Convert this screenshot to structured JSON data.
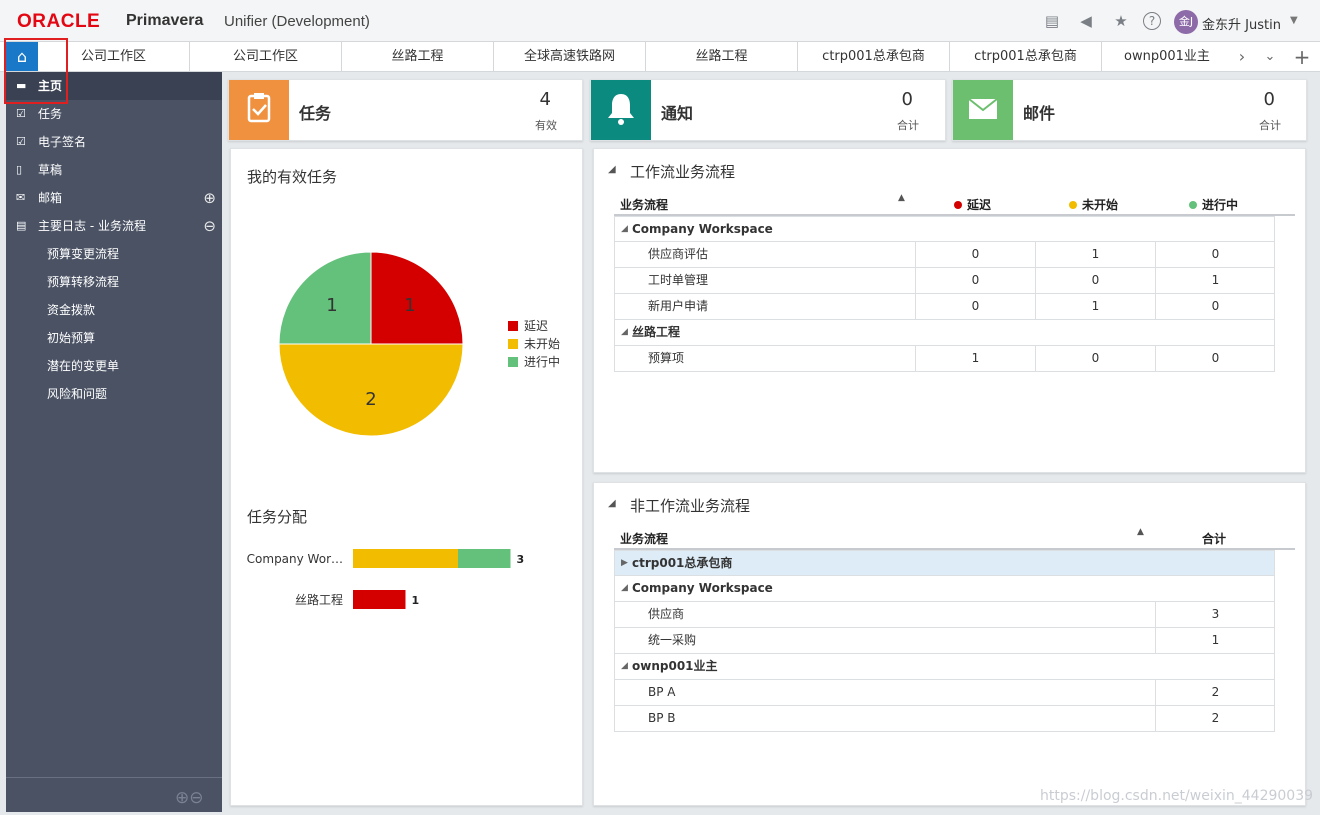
{
  "header": {
    "logo": "ORACLE",
    "product": "Primavera",
    "app": "Unifier  (Development)",
    "user_initials": "金J",
    "user_name": "金东升 Justin"
  },
  "tabs": [
    "公司工作区",
    "公司工作区",
    "丝路工程",
    "全球高速铁路网",
    "丝路工程",
    "ctrp001总承包商",
    "ctrp001总承包商",
    "ownp001业主"
  ],
  "sidebar": {
    "items": [
      {
        "label": "主页",
        "icon": "folder-icon"
      },
      {
        "label": "任务",
        "icon": "task-icon"
      },
      {
        "label": "电子签名",
        "icon": "signature-icon"
      },
      {
        "label": "草稿",
        "icon": "draft-icon"
      },
      {
        "label": "邮箱",
        "icon": "mail-icon"
      },
      {
        "label": "主要日志 - 业务流程",
        "icon": "log-icon"
      }
    ],
    "subitems": [
      "预算变更流程",
      "预算转移流程",
      "资金拨款",
      "初始预算",
      "潜在的变更单",
      "风险和问题"
    ]
  },
  "kpi": [
    {
      "title": "任务",
      "value": "4",
      "sub": "有效",
      "color": "#f0913f"
    },
    {
      "title": "通知",
      "value": "0",
      "sub": "合计",
      "color": "#0b8a80"
    },
    {
      "title": "邮件",
      "value": "0",
      "sub": "合计",
      "color": "#6cbf6e"
    }
  ],
  "tasks_panel": {
    "title": "我的有效任务"
  },
  "chart_data": [
    {
      "type": "pie",
      "categories": [
        "延迟",
        "未开始",
        "进行中"
      ],
      "values": [
        1,
        2,
        1
      ],
      "colors": [
        "#d40000",
        "#f2bc00",
        "#64c17b"
      ],
      "legend": "right"
    },
    {
      "type": "bar",
      "title": "任务分配",
      "stacked": true,
      "orientation": "horizontal",
      "categories": [
        "Company Wor…",
        "丝路工程"
      ],
      "series": [
        {
          "name": "延迟",
          "values": [
            0,
            1
          ],
          "color": "#d40000"
        },
        {
          "name": "未开始",
          "values": [
            2,
            0
          ],
          "color": "#f2bc00"
        },
        {
          "name": "进行中",
          "values": [
            1,
            0
          ],
          "color": "#64c17b"
        }
      ],
      "totals": [
        "3",
        "1"
      ]
    }
  ],
  "workflow": {
    "title": "工作流业务流程",
    "col_bp": "业务流程",
    "cols": [
      {
        "label": "延迟",
        "color": "#d40000"
      },
      {
        "label": "未开始",
        "color": "#f2bc00"
      },
      {
        "label": "进行中",
        "color": "#64c17b"
      }
    ],
    "groups": [
      {
        "name": "Company Workspace",
        "rows": [
          {
            "name": "供应商评估",
            "v": [
              "0",
              "1",
              "0"
            ]
          },
          {
            "name": "工时单管理",
            "v": [
              "0",
              "0",
              "1"
            ]
          },
          {
            "name": "新用户申请",
            "v": [
              "0",
              "1",
              "0"
            ]
          }
        ]
      },
      {
        "name": "丝路工程",
        "rows": [
          {
            "name": "预算项",
            "v": [
              "1",
              "0",
              "0"
            ]
          }
        ]
      }
    ]
  },
  "nonworkflow": {
    "title": "非工作流业务流程",
    "col_bp": "业务流程",
    "col_total": "合计",
    "groups": [
      {
        "name": "ctrp001总承包商",
        "rows": []
      },
      {
        "name": "Company Workspace",
        "rows": [
          {
            "name": "供应商",
            "v": "3"
          },
          {
            "name": "统一采购",
            "v": "1"
          }
        ]
      },
      {
        "name": "ownp001业主",
        "rows": [
          {
            "name": "BP A",
            "v": "2"
          },
          {
            "name": "BP B",
            "v": "2"
          }
        ]
      }
    ]
  },
  "watermark": "https://blog.csdn.net/weixin_44290039"
}
